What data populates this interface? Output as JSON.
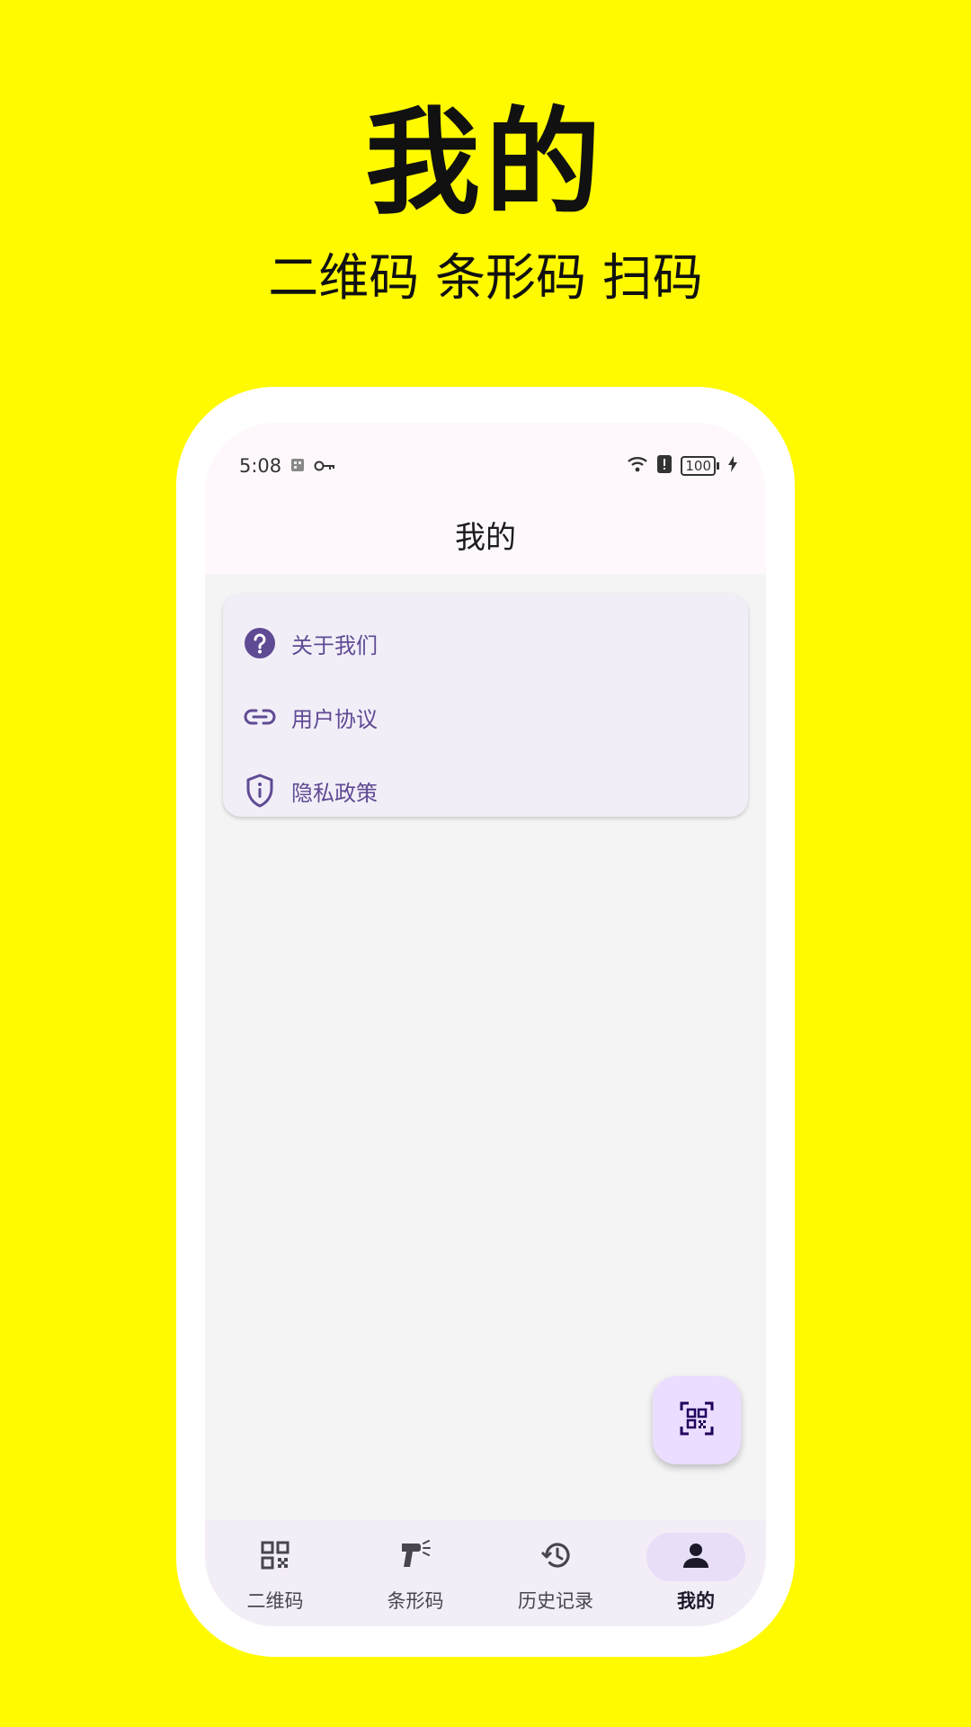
{
  "promo": {
    "title": "我的",
    "subtitle": "二维码 条形码 扫码"
  },
  "status_bar": {
    "time": "5:08",
    "battery": "100",
    "icons_left": [
      "sim-card-icon",
      "key-icon"
    ],
    "icons_right": [
      "wifi-icon",
      "alert-icon",
      "battery-icon",
      "charging-icon"
    ]
  },
  "app_bar": {
    "title": "我的"
  },
  "menu": {
    "items": [
      {
        "label": "关于我们",
        "icon": "help-circle-icon"
      },
      {
        "label": "用户协议",
        "icon": "link-icon"
      },
      {
        "label": "隐私政策",
        "icon": "shield-info-icon"
      }
    ]
  },
  "fab": {
    "icon": "qr-scan-icon"
  },
  "bottom_nav": {
    "items": [
      {
        "label": "二维码",
        "icon": "qr-code-icon",
        "active": false
      },
      {
        "label": "条形码",
        "icon": "barcode-scanner-icon",
        "active": false
      },
      {
        "label": "历史记录",
        "icon": "history-icon",
        "active": false
      },
      {
        "label": "我的",
        "icon": "person-icon",
        "active": true
      }
    ]
  },
  "colors": {
    "background": "#FFFA00",
    "accent": "#5F4A94",
    "nav_active_pill": "#E8DEF8",
    "fab": "#EADDFF"
  }
}
